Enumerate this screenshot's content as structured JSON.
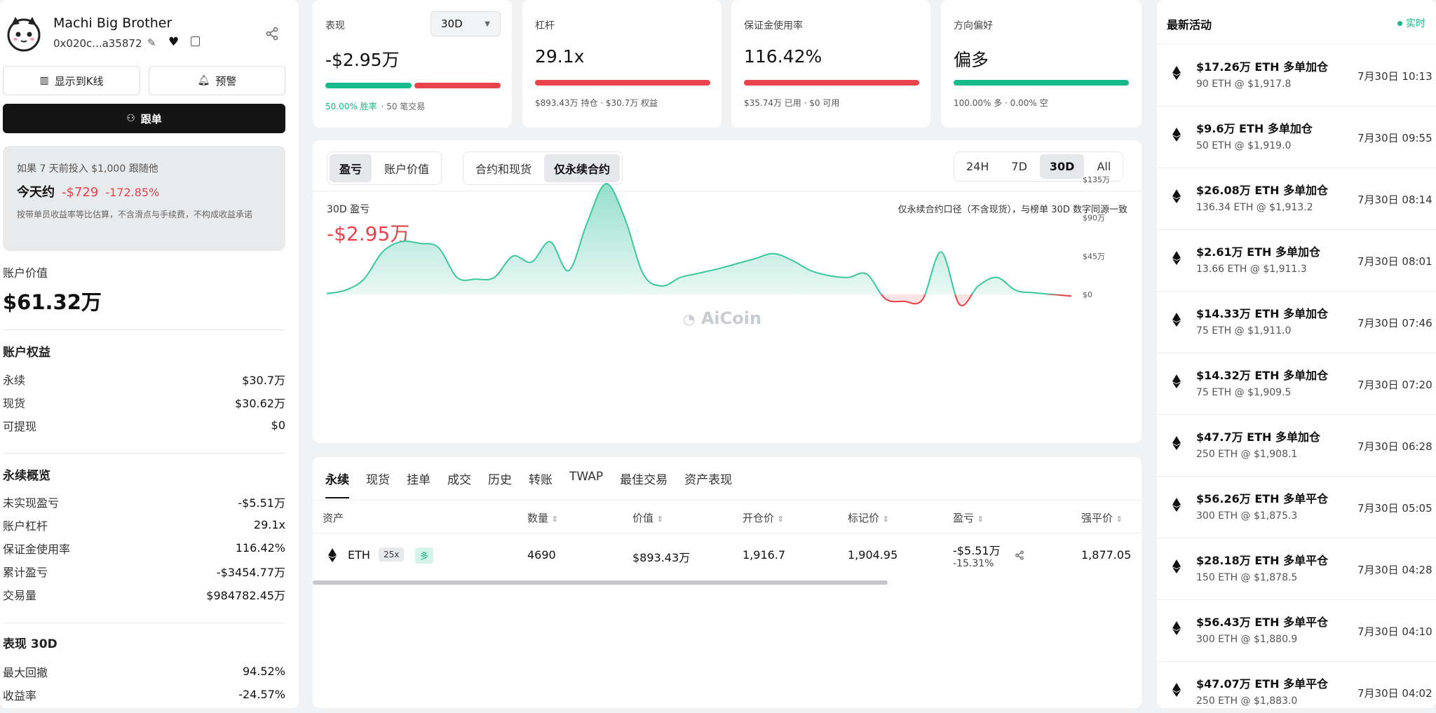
{
  "profile": {
    "name": "Machi Big Brother",
    "address": "0x020c...a35872",
    "show_kline_label": "显示到K线",
    "alert_label": "预警",
    "follow_label": "跟单"
  },
  "sim": {
    "line1": "如果 7 天前投入 $1,000 跟随他",
    "today_label": "今天约",
    "today_value": "-$729",
    "today_pct": "-172.85%",
    "note": "按带单员收益率等比估算，不含滑点与手续费，不构成收益承诺"
  },
  "account": {
    "value_label": "账户价值",
    "value": "$61.32万",
    "equity_label": "账户权益",
    "equity": [
      {
        "k": "永续",
        "v": "$30.7万"
      },
      {
        "k": "现货",
        "v": "$30.62万"
      },
      {
        "k": "可提现",
        "v": "$0"
      }
    ],
    "perp_label": "永续概览",
    "perp": [
      {
        "k": "未实现盈亏",
        "v": "-$5.51万",
        "neg": true
      },
      {
        "k": "账户杠杆",
        "v": "29.1x"
      },
      {
        "k": "保证金使用率",
        "v": "116.42%"
      },
      {
        "k": "累计盈亏",
        "v": "-$3454.77万",
        "neg": true
      },
      {
        "k": "交易量",
        "v": "$984782.45万"
      }
    ],
    "perf_label": "表现 30D",
    "perf": [
      {
        "k": "最大回撤",
        "v": "94.52%"
      },
      {
        "k": "收益率",
        "v": "-24.57%",
        "neg": true
      }
    ]
  },
  "stats": {
    "perf": {
      "label": "表现",
      "select": "30D",
      "value": "-$2.95万",
      "winrate": "50.00% 胜率",
      "trades": "· 50 笔交易",
      "win_fraction": 0.5
    },
    "lev": {
      "label": "杠杆",
      "value": "29.1x",
      "sub": "$893.43万 持仓 · $30.7万 权益"
    },
    "margin": {
      "label": "保证金使用率",
      "value": "116.42%",
      "sub": "$35.74万 已用 · $0 可用"
    },
    "dir": {
      "label": "方向偏好",
      "value": "偏多",
      "sub": "100.00% 多 · 0.00% 空",
      "long_fraction": 1.0
    }
  },
  "chart_panel": {
    "tabs_left": [
      "盈亏",
      "账户价值"
    ],
    "tabs_mid": [
      "合约和现货",
      "仅永续合约"
    ],
    "ranges": [
      "24H",
      "7D",
      "30D",
      "All"
    ],
    "title": "30D 盈亏",
    "value": "-$2.95万",
    "note": "仅永续合约口径（不含现货），与榜单 30D 数字同源一致",
    "watermark": "AiCoin"
  },
  "chart_data": {
    "type": "area",
    "title": "30D 盈亏",
    "y_tick_labels": [
      "$135万",
      "$90万",
      "$45万",
      "$0"
    ],
    "y_ticks": [
      135,
      90,
      45,
      0
    ],
    "ylim": [
      -15,
      135
    ],
    "x": [
      0,
      1,
      2,
      3,
      4,
      5,
      6,
      7,
      8,
      9,
      10,
      11,
      12,
      13,
      14,
      15,
      16,
      17,
      18,
      19,
      20,
      21,
      22,
      23,
      24,
      25,
      26,
      27,
      28,
      29,
      30,
      31,
      32,
      33,
      34,
      35,
      36,
      37,
      38,
      39,
      40
    ],
    "values": [
      1,
      5,
      18,
      50,
      62,
      60,
      55,
      20,
      18,
      20,
      45,
      38,
      62,
      28,
      85,
      130,
      90,
      24,
      10,
      20,
      25,
      30,
      36,
      42,
      48,
      40,
      28,
      22,
      20,
      24,
      -5,
      -8,
      -6,
      50,
      -12,
      10,
      20,
      5,
      2,
      0,
      -2
    ]
  },
  "table": {
    "tabs": [
      "永续",
      "现货",
      "挂单",
      "成交",
      "历史",
      "转账",
      "TWAP",
      "最佳交易",
      "资产表现"
    ],
    "headers": [
      "资产",
      "数量",
      "价值",
      "开仓价",
      "标记价",
      "盈亏",
      "强平价"
    ],
    "row": {
      "asset": "ETH",
      "leverage": "25x",
      "side": "多",
      "qty": "4690",
      "value": "$893.43万",
      "entry": "1,916.7",
      "mark": "1,904.95",
      "pnl": "-$5.51万",
      "pnl_pct": "-15.31%",
      "liq": "1,877.05"
    }
  },
  "activity": {
    "title": "最新活动",
    "live": "实时",
    "items": [
      {
        "t1": "$17.26万 ETH 多单加仓",
        "t2": "90 ETH @ $1,917.8",
        "time": "7月30日 10:13"
      },
      {
        "t1": "$9.6万 ETH 多单加仓",
        "t2": "50 ETH @ $1,919.0",
        "time": "7月30日 09:55"
      },
      {
        "t1": "$26.08万 ETH 多单加仓",
        "t2": "136.34 ETH @ $1,913.2",
        "time": "7月30日 08:14"
      },
      {
        "t1": "$2.61万 ETH 多单加仓",
        "t2": "13.66 ETH @ $1,911.3",
        "time": "7月30日 08:01"
      },
      {
        "t1": "$14.33万 ETH 多单加仓",
        "t2": "75 ETH @ $1,911.0",
        "time": "7月30日 07:46"
      },
      {
        "t1": "$14.32万 ETH 多单加仓",
        "t2": "75 ETH @ $1,909.5",
        "time": "7月30日 07:20"
      },
      {
        "t1": "$47.7万 ETH 多单加仓",
        "t2": "250 ETH @ $1,908.1",
        "time": "7月30日 06:28"
      },
      {
        "t1": "$56.26万 ETH 多单平仓",
        "t2": "300 ETH @ $1,875.3",
        "time": "7月30日 05:05"
      },
      {
        "t1": "$28.18万 ETH 多单平仓",
        "t2": "150 ETH @ $1,878.5",
        "time": "7月30日 04:28"
      },
      {
        "t1": "$56.43万 ETH 多单平仓",
        "t2": "300 ETH @ $1,880.9",
        "time": "7月30日 04:10"
      },
      {
        "t1": "$47.07万 ETH 多单平仓",
        "t2": "250 ETH @ $1,883.0",
        "time": "7月30日 04:02"
      }
    ]
  },
  "colors": {
    "red": "#e8434a",
    "green": "#16b98a",
    "dark": "#141414"
  }
}
